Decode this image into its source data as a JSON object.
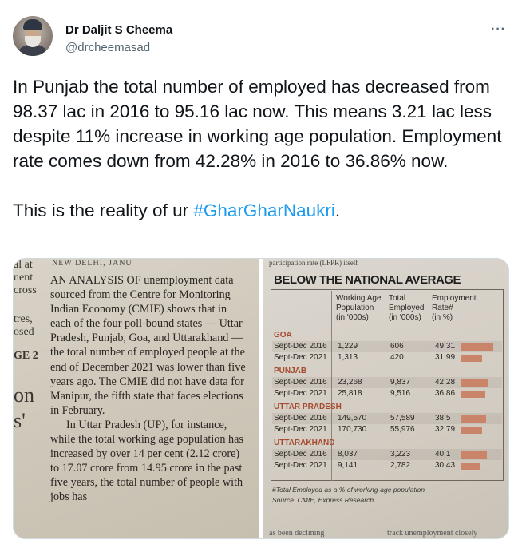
{
  "author": {
    "name": "Dr Daljit S Cheema",
    "handle": "@drcheemasad",
    "more_icon": "more-horizontal-icon"
  },
  "tweet": {
    "text": "In Punjab the total number of employed has decreased from 98.37 lac in 2016 to 95.16 lac now. This means 3.21 lac less despite 11% increase in working age population. Employment rate comes down from 42.28% in 2016 to 36.86% now.\n\nThis is the reality of ur ",
    "hashtag": "#GharGharNaukri",
    "trailing": "."
  },
  "media_left": {
    "top_fragment": "NEW DELHI, JANU",
    "margin_fragments": [
      "al at",
      "nent",
      "cross",
      "tres,",
      "osed",
      "GE 2",
      "on",
      "s'"
    ],
    "paragraph1": "AN ANALYSIS OF unemployment data sourced from the Centre for Monitoring Indian Economy (CMIE) shows that in each of the four poll-bound states — Uttar Pradesh, Punjab, Goa, and Uttarakhand — the total number of employed people at the end of December 2021 was lower than five years ago. The CMIE did not have data for Manipur, the fifth state that faces elections in February.",
    "paragraph2": "In Uttar Pradesh (UP), for instance, while the total working age population has increased by over 14 per cent (2.12 crore) to 17.07 crore from 14.95 crore in the past five years, the total number of people with jobs has"
  },
  "media_right": {
    "top_fragment": "participation rate (LFPR) itself",
    "title": "BELOW THE NATIONAL AVERAGE",
    "headers": {
      "wap": [
        "Working Age",
        "Population",
        "(in '000s)"
      ],
      "emp": [
        "Total",
        "Employed",
        "(in '000s)"
      ],
      "rate": [
        "Employment",
        "Rate#",
        "(in %)"
      ]
    },
    "states": [
      {
        "name": "GOA",
        "rows": [
          {
            "period": "Sept-Dec 2016",
            "wap": "1,229",
            "emp": "606",
            "rate": "49.31",
            "rate_value": 49.31
          },
          {
            "period": "Sept-Dec 2021",
            "wap": "1,313",
            "emp": "420",
            "rate": "31.99",
            "rate_value": 31.99
          }
        ]
      },
      {
        "name": "PUNJAB",
        "rows": [
          {
            "period": "Sept-Dec 2016",
            "wap": "23,268",
            "emp": "9,837",
            "rate": "42.28",
            "rate_value": 42.28
          },
          {
            "period": "Sept-Dec 2021",
            "wap": "25,818",
            "emp": "9,516",
            "rate": "36.86",
            "rate_value": 36.86
          }
        ]
      },
      {
        "name": "UTTAR PRADESH",
        "rows": [
          {
            "period": "Sept-Dec 2016",
            "wap": "149,570",
            "emp": "57,589",
            "rate": "38.5",
            "rate_value": 38.5
          },
          {
            "period": "Sept-Dec 2021",
            "wap": "170,730",
            "emp": "55,976",
            "rate": "32.79",
            "rate_value": 32.79
          }
        ]
      },
      {
        "name": "UTTARAKHAND",
        "rows": [
          {
            "period": "Sept-Dec 2016",
            "wap": "8,037",
            "emp": "3,223",
            "rate": "40.1",
            "rate_value": 40.1
          },
          {
            "period": "Sept-Dec 2021",
            "wap": "9,141",
            "emp": "2,782",
            "rate": "30.43",
            "rate_value": 30.43
          }
        ]
      }
    ],
    "footnote1": "#Total Employed as a % of working-age population",
    "footnote2": "Source: CMIE, Express Research",
    "bottom_left": "as been declining",
    "bottom_right": "track unemployment closely"
  }
}
